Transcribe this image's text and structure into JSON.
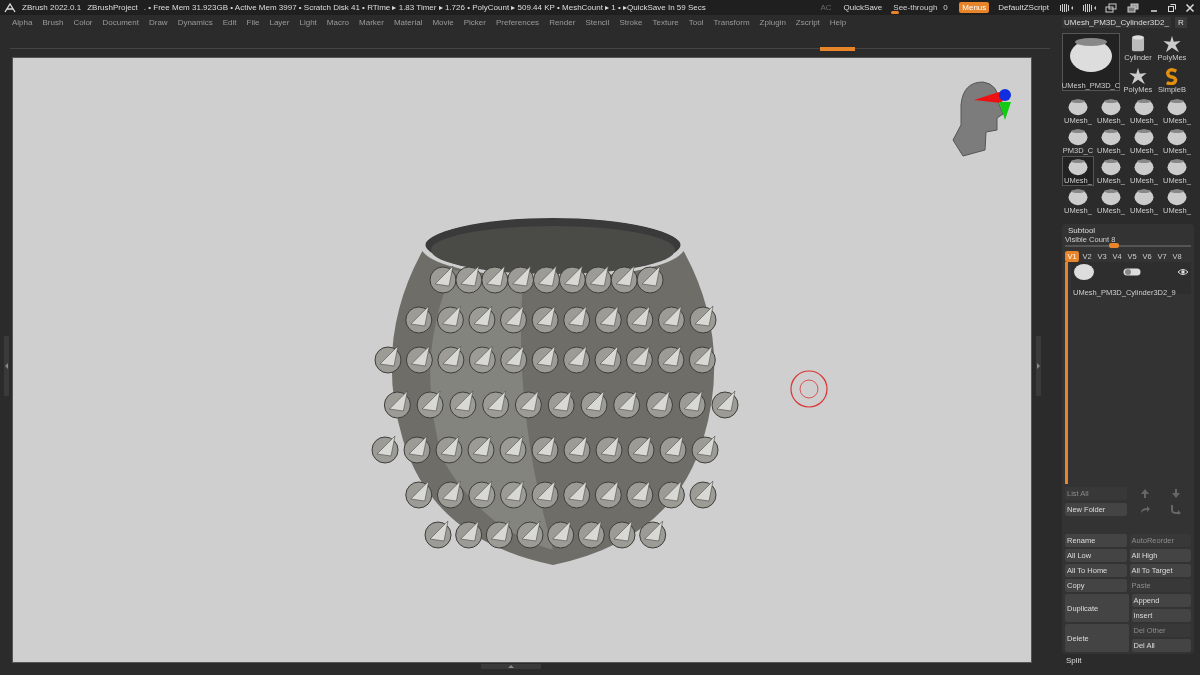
{
  "title_bar": {
    "app": "ZBrush 2022.0.1",
    "project": "ZBrushProject",
    "status": ". • Free Mem 31.923GB • Active Mem 3997 • Scratch Disk 41 •  RTime ▸ 1.83 Timer ▸ 1.726 • PolyCount ▸ 509.44 KP • MeshCount ▸ 1 • ▸QuickSave In 59 Secs",
    "ac": {
      "label": "AC",
      "disabled": true
    },
    "quicksave": "QuickSave",
    "see_through": {
      "label": "See-through",
      "value": "0",
      "level": 0.13
    },
    "menus": {
      "label": "Menus",
      "on": true
    },
    "script": "DefaultZScript"
  },
  "menu_bar": [
    "Alpha",
    "Brush",
    "Color",
    "Document",
    "Draw",
    "Dynamics",
    "Edit",
    "File",
    "Layer",
    "Light",
    "Macro",
    "Marker",
    "Material",
    "Movie",
    "Picker",
    "Preferences",
    "Render",
    "Stencil",
    "Stroke",
    "Texture",
    "Tool",
    "Transform",
    "Zplugin",
    "Zscript",
    "Help"
  ],
  "tool_panel": {
    "title": "UMesh_PM3D_Cylinder3D2_",
    "button": "R",
    "main_tool": {
      "label": "UMesh_PM3D_C",
      "selected": true
    },
    "small_tools": [
      {
        "label": "Cylinder",
        "kind": "cylinder"
      },
      {
        "label": "PolyMes",
        "kind": "star"
      },
      {
        "label": "PolyMes",
        "kind": "star"
      },
      {
        "label": "SimpleB",
        "kind": "s"
      }
    ],
    "grid": [
      {
        "label": "UMesh_",
        "selected": false
      },
      {
        "label": "UMesh_",
        "selected": false
      },
      {
        "label": "UMesh_",
        "selected": false
      },
      {
        "label": "UMesh_",
        "selected": false
      },
      {
        "label": "PM3D_C",
        "selected": false
      },
      {
        "label": "UMesh_",
        "selected": false
      },
      {
        "label": "UMesh_",
        "selected": false
      },
      {
        "label": "UMesh_",
        "selected": false
      },
      {
        "label": "UMesh_",
        "selected": true
      },
      {
        "label": "UMesh_",
        "selected": false
      },
      {
        "label": "UMesh_",
        "selected": false
      },
      {
        "label": "UMesh_",
        "selected": false
      },
      {
        "label": "UMesh_",
        "selected": false
      },
      {
        "label": "UMesh_",
        "selected": false
      },
      {
        "label": "UMesh_",
        "selected": false
      },
      {
        "label": "UMesh_",
        "selected": false
      }
    ]
  },
  "subtool": {
    "title": "Subtool",
    "visible_count": {
      "label": "Visible Count 8",
      "level": 0.35
    },
    "tabs": [
      {
        "label": "V1",
        "selected": true
      },
      {
        "label": "V2",
        "selected": false
      },
      {
        "label": "V3",
        "selected": false
      },
      {
        "label": "V4",
        "selected": false
      },
      {
        "label": "V5",
        "selected": false
      },
      {
        "label": "V6",
        "selected": false
      },
      {
        "label": "V7",
        "selected": false
      },
      {
        "label": "V8",
        "selected": false
      }
    ],
    "item": {
      "name": "UMesh_PM3D_Cylinder3D2_9",
      "visible": true
    },
    "buttons": [
      {
        "label": "List All",
        "disabled": true
      },
      {
        "label": "New Folder",
        "disabled": false
      }
    ],
    "actions": [
      {
        "label": "Rename",
        "disabled": false
      },
      {
        "label": "AutoReorder",
        "disabled": true
      },
      {
        "label": "All Low",
        "disabled": false
      },
      {
        "label": "All High",
        "disabled": false
      },
      {
        "label": "All To Home",
        "disabled": false
      },
      {
        "label": "All To Target",
        "disabled": false
      },
      {
        "label": "Copy",
        "disabled": false
      },
      {
        "label": "Paste",
        "disabled": true
      }
    ],
    "edit_groups": [
      {
        "label": "Duplicate",
        "options": [
          {
            "label": "Append",
            "disabled": false
          },
          {
            "label": "Insert",
            "disabled": false
          }
        ]
      },
      {
        "label": "Delete",
        "options": [
          {
            "label": "Del Other",
            "disabled": true
          },
          {
            "label": "Del All",
            "disabled": false
          }
        ]
      }
    ],
    "next_section": "Split"
  }
}
